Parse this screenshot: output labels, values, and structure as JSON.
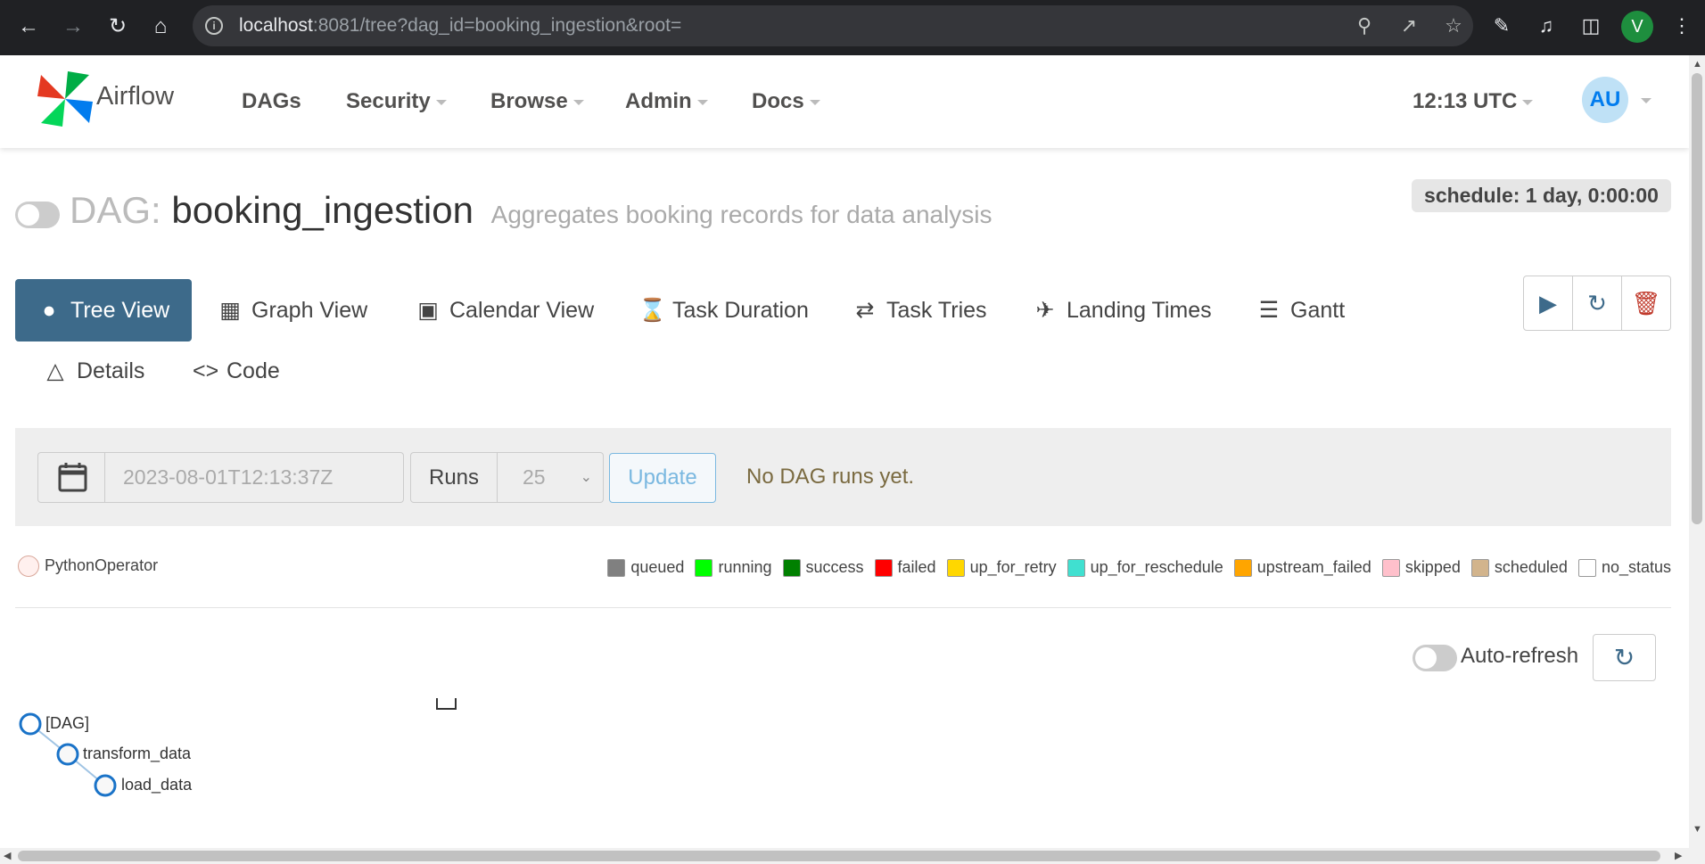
{
  "browser": {
    "url_host": "localhost",
    "url_rest": ":8081/tree?dag_id=booking_ingestion&root=",
    "profile_initial": "V"
  },
  "navbar": {
    "brand": "Airflow",
    "menu": [
      "DAGs",
      "Security",
      "Browse",
      "Admin",
      "Docs"
    ],
    "clock": "12:13 UTC",
    "user_initials": "AU"
  },
  "dag": {
    "prefix": "DAG:",
    "name": "booking_ingestion",
    "description": "Aggregates booking records for data analysis",
    "schedule": "schedule: 1 day, 0:00:00"
  },
  "tabs": [
    {
      "label": "Tree View",
      "icon": "tree-icon",
      "active": true
    },
    {
      "label": "Graph View",
      "icon": "graph-icon"
    },
    {
      "label": "Calendar View",
      "icon": "calendar-icon"
    },
    {
      "label": "Task Duration",
      "icon": "hourglass-icon"
    },
    {
      "label": "Task Tries",
      "icon": "repeat-icon"
    },
    {
      "label": "Landing Times",
      "icon": "plane-landing-icon"
    },
    {
      "label": "Gantt",
      "icon": "gantt-icon"
    },
    {
      "label": "Details",
      "icon": "warning-triangle-icon"
    },
    {
      "label": "Code",
      "icon": "code-icon"
    }
  ],
  "form": {
    "date_value": "2023-08-01T12:13:37Z",
    "runs_label": "Runs",
    "runs_value": "25",
    "update_label": "Update",
    "message": "No DAG runs yet."
  },
  "legend": {
    "operator": "PythonOperator",
    "states": [
      {
        "name": "queued",
        "color": "#808080"
      },
      {
        "name": "running",
        "color": "#00ff00"
      },
      {
        "name": "success",
        "color": "#008000"
      },
      {
        "name": "failed",
        "color": "#ff0000"
      },
      {
        "name": "up_for_retry",
        "color": "#ffd700"
      },
      {
        "name": "up_for_reschedule",
        "color": "#40e0d0"
      },
      {
        "name": "upstream_failed",
        "color": "#ffa500"
      },
      {
        "name": "skipped",
        "color": "#ffc0cb"
      },
      {
        "name": "scheduled",
        "color": "#d2b48c"
      },
      {
        "name": "no_status",
        "color": "#ffffff"
      }
    ]
  },
  "auto_refresh_label": "Auto-refresh",
  "tree": {
    "nodes": [
      "[DAG]",
      "transform_data",
      "load_data"
    ]
  }
}
